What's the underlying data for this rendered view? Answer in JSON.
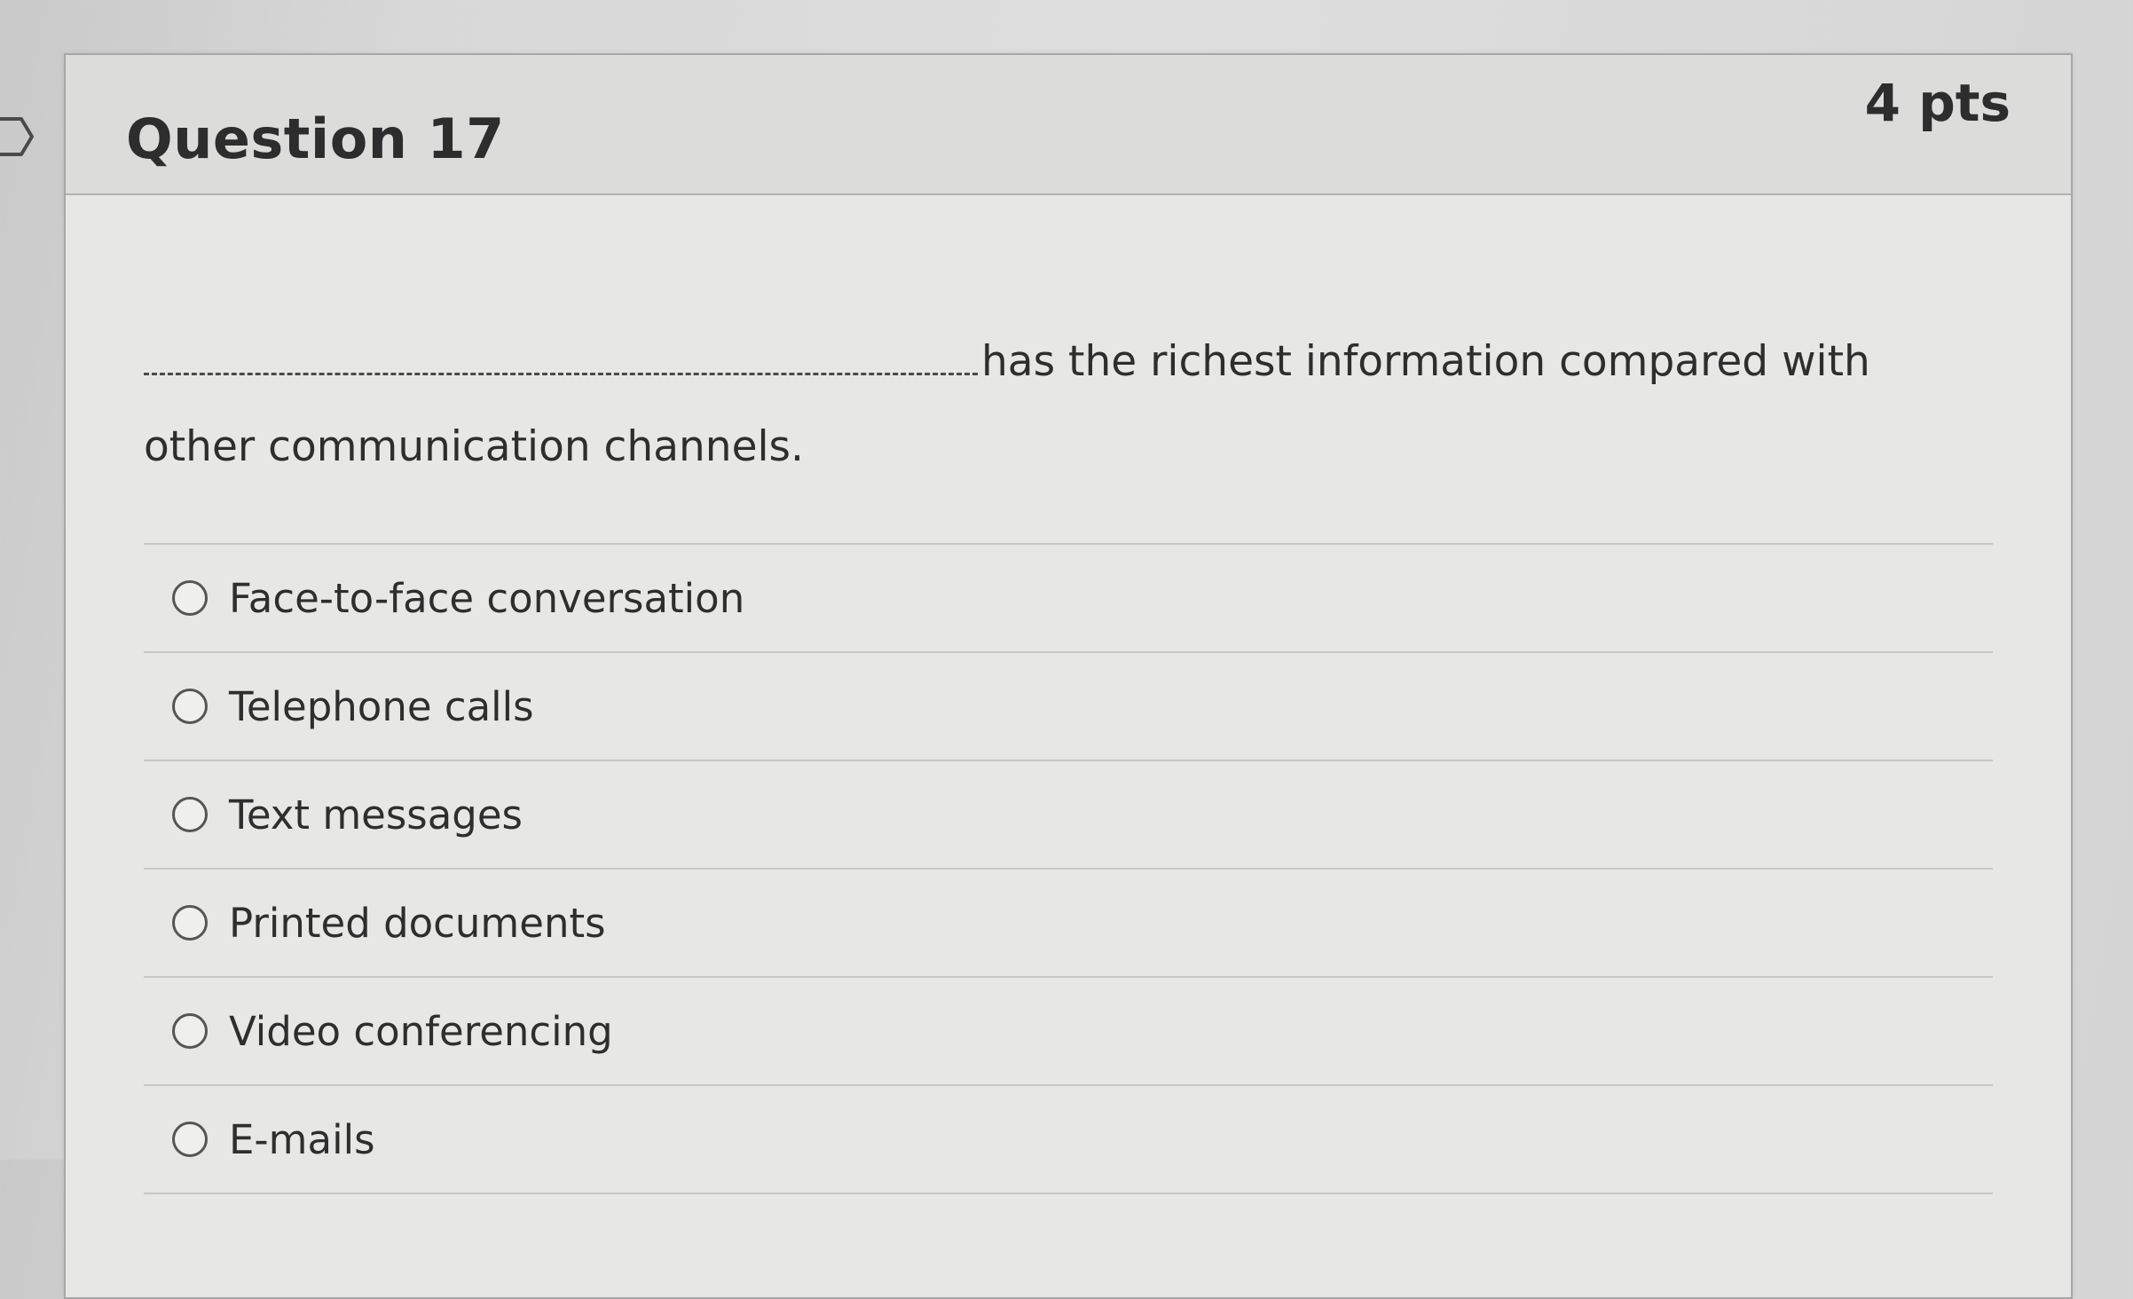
{
  "question": {
    "title": "Question 17",
    "points": "4 pts",
    "prompt_after_blank": "has the richest information compared with other communication channels."
  },
  "answers": [
    {
      "label": "Face-to-face conversation"
    },
    {
      "label": "Telephone calls"
    },
    {
      "label": "Text messages"
    },
    {
      "label": "Printed documents"
    },
    {
      "label": "Video conferencing"
    },
    {
      "label": "E-mails"
    }
  ],
  "colors": {
    "background": "#d8d8d8",
    "card": "#e7e7e5",
    "header": "#dcdcda",
    "text": "#2d2d2d"
  },
  "icons": {
    "flag": "flag-question-icon",
    "radio": "radio-unchecked-icon"
  }
}
